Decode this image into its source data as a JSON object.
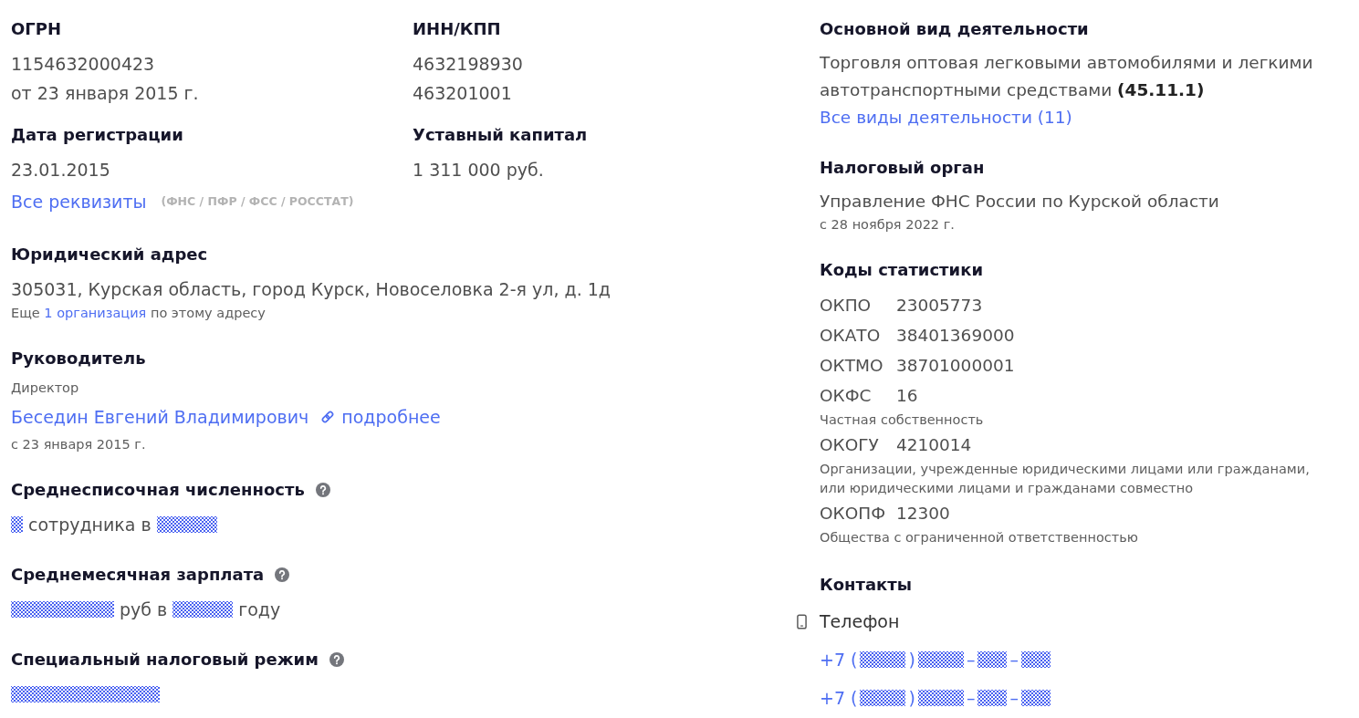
{
  "requisites": {
    "fields": [
      {
        "label": "ОГРН",
        "lines": [
          "1154632000423",
          "от 23 января 2015 г."
        ]
      },
      {
        "label": "ИНН/КПП",
        "lines": [
          "4632198930",
          "463201001"
        ]
      },
      {
        "label": "Дата регистрации",
        "lines": [
          "23.01.2015"
        ]
      },
      {
        "label": "Уставный капитал",
        "lines": [
          "1 311 000 руб."
        ]
      }
    ],
    "all_link": "Все реквизиты",
    "sources_note": "(ФНС / ПФР / ФСС / РОССТАТ)"
  },
  "legal_address": {
    "title": "Юридический адрес",
    "value": "305031, Курская область, город Курск, Новоселовка 2-я ул, д. 1д",
    "note": {
      "before": "Еще",
      "link": "1 организация",
      "after": "по этому адресу"
    }
  },
  "director": {
    "title": "Руководитель",
    "role": "Директор",
    "name": "Беседин Евгений Владимирович",
    "more_link": "подробнее",
    "since": "с 23 января 2015 г."
  },
  "stat_blocks": [
    {
      "title": "Среднесписочная численность",
      "help": true,
      "value": [
        {
          "kind": "mask_xs"
        },
        {
          "kind": "text",
          "text": "сотрудника в"
        },
        {
          "kind": "mask_l"
        }
      ]
    },
    {
      "title": "Среднемесячная зарплата",
      "help": true,
      "value": [
        {
          "kind": "mask_xl"
        },
        {
          "kind": "text",
          "text": "руб в"
        },
        {
          "kind": "mask_l"
        },
        {
          "kind": "text",
          "text": "году"
        }
      ]
    },
    {
      "title": "Специальный налоговый режим",
      "help": true,
      "value": [
        {
          "kind": "mask_xxl"
        }
      ]
    }
  ],
  "main_activity": {
    "title": "Основной вид деятельности",
    "description": "Торговля оптовая легковыми автомобилями и легкими автотранспортными средствами **(45.11.1)**",
    "all_link": "Все виды деятельности (11)"
  },
  "tax_authority": {
    "title": "Налоговый орган",
    "name": "Управление ФНС России по Курской области",
    "since": "с 28 ноября 2022 г."
  },
  "stat_codes": {
    "title": "Коды статистики",
    "codes": [
      {
        "code": "ОКПО",
        "value": "23005773"
      },
      {
        "code": "ОКАТО",
        "value": "38401369000"
      },
      {
        "code": "ОКТМО",
        "value": "38701000001"
      },
      {
        "code": "ОКФС",
        "value": "16",
        "note": "Частная собственность"
      },
      {
        "code": "ОКОГУ",
        "value": "4210014",
        "note": "Организации, учрежденные юридическими лицами или гражданами, или юридическими лицами и гражданами совместно"
      },
      {
        "code": "ОКОПФ",
        "value": "12300",
        "note": "Общества с ограниченной ответственностью"
      }
    ]
  },
  "contacts": {
    "title": "Контакты",
    "phone_label": "Телефон",
    "phones": [
      {
        "segments": [
          {
            "kind": "text",
            "text": "+7 ("
          },
          {
            "kind": "mask_m"
          },
          {
            "kind": "text",
            "text": ")"
          },
          {
            "kind": "mask_m"
          },
          {
            "kind": "text",
            "text": "–"
          },
          {
            "kind": "mask_s"
          },
          {
            "kind": "text",
            "text": "–"
          },
          {
            "kind": "mask_s"
          }
        ]
      },
      {
        "segments": [
          {
            "kind": "text",
            "text": "+7 ("
          },
          {
            "kind": "mask_m"
          },
          {
            "kind": "text",
            "text": ")"
          },
          {
            "kind": "mask_m"
          },
          {
            "kind": "text",
            "text": "–"
          },
          {
            "kind": "mask_s"
          },
          {
            "kind": "text",
            "text": "–"
          },
          {
            "kind": "mask_s"
          }
        ]
      }
    ]
  }
}
